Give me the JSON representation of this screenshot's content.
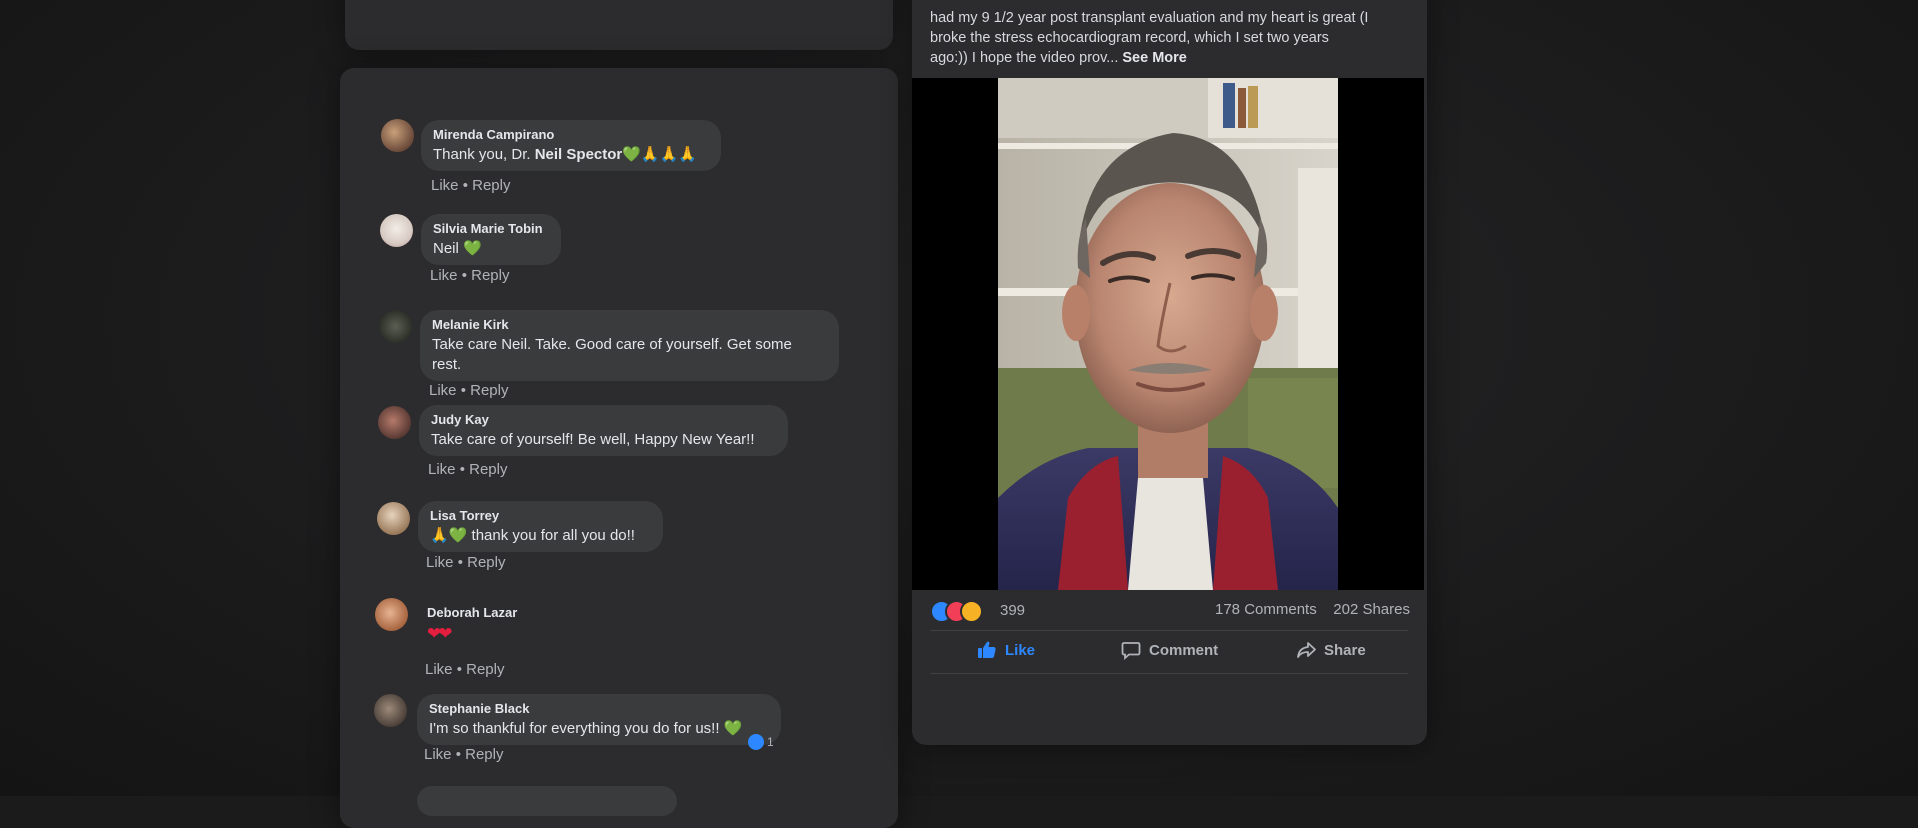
{
  "post": {
    "text_line1": "had my 9 1/2 year post transplant evaluation and my heart is great (I",
    "text_line2": "broke the stress echocardiogram record, which I set two years",
    "text_line3": "ago:)) I hope the video prov...",
    "see_more": "See More",
    "reaction_count": "399",
    "comments_count": "178 Comments",
    "shares_count": "202 Shares",
    "like_label": "Like",
    "comment_label": "Comment",
    "share_label": "Share"
  },
  "comments": [
    {
      "author": "Mirenda Campirano",
      "text_prefix": "Thank you, Dr. ",
      "mention": "Neil Spector",
      "emoji": "💚🙏🙏🙏",
      "like": "Like",
      "sep": " • ",
      "reply": "Reply"
    },
    {
      "author": "Silvia Marie Tobin",
      "text": "Neil",
      "emoji": "💚",
      "like": "Like",
      "sep": " • ",
      "reply": "Reply"
    },
    {
      "author": "Melanie Kirk",
      "text_line1": "Take care Neil. Take. Good care of yourself. Get some",
      "text_line2": "rest.",
      "like": "Like",
      "sep": " • ",
      "reply": "Reply"
    },
    {
      "author": "Judy Kay",
      "text": "Take care of yourself! Be well, Happy New Year!!",
      "like": "Like",
      "sep": " • ",
      "reply": "Reply"
    },
    {
      "author": "Lisa Torrey",
      "emoji": "🙏💚",
      "text": " thank you for all you do!!",
      "like": "Like",
      "sep": " • ",
      "reply": "Reply"
    },
    {
      "author": "Deborah Lazar",
      "emoji": "❤❤",
      "like": "Like",
      "sep": " • ",
      "reply": "Reply"
    },
    {
      "author": "Stephanie Black",
      "text": "I'm so thankful for everything you do for us!!",
      "emoji": "💚",
      "reaction_count": "1",
      "like": "Like",
      "sep": " • ",
      "reply": "Reply"
    }
  ],
  "colors": {
    "panel": "#2c2c2e",
    "bubble": "#3a3b3c",
    "like_blue": "#2d88ff",
    "heart_green": "#45bd62",
    "heart_red": "#e41e3f"
  }
}
